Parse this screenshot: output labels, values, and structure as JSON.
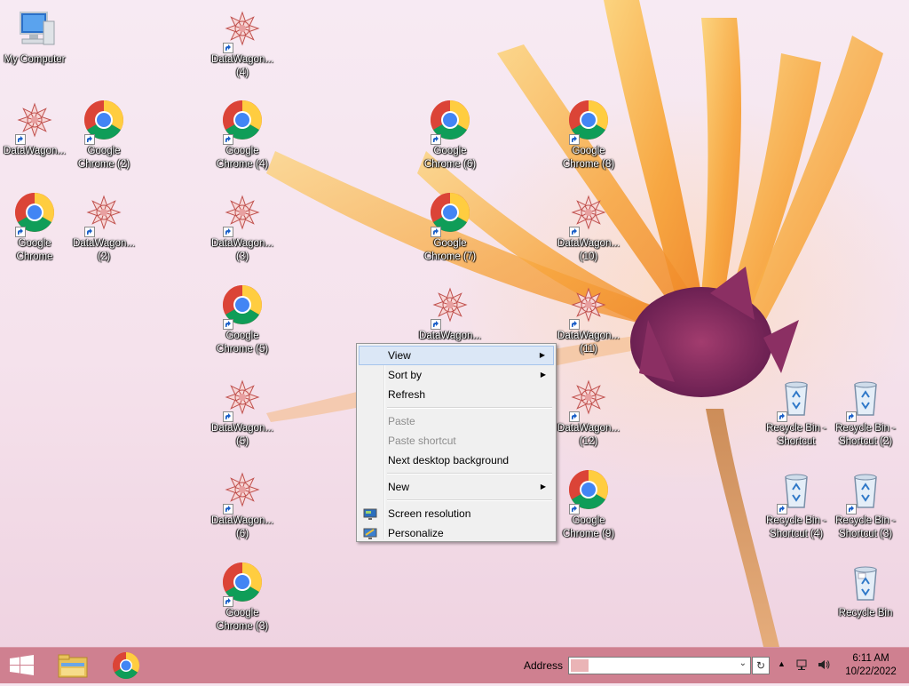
{
  "desktop": {
    "icons": [
      {
        "type": "computer",
        "label": "My Computer"
      },
      {
        "type": "datawagon",
        "label": "DataWagon..."
      },
      {
        "type": "chrome",
        "label": "Google Chrome (2)"
      },
      {
        "type": "chrome",
        "label": "Google Chrome"
      },
      {
        "type": "datawagon",
        "label": "DataWagon... (2)"
      },
      {
        "type": "datawagon",
        "label": "DataWagon... (4)"
      },
      {
        "type": "chrome",
        "label": "Google Chrome (4)"
      },
      {
        "type": "datawagon",
        "label": "DataWagon... (3)"
      },
      {
        "type": "chrome",
        "label": "Google Chrome (5)"
      },
      {
        "type": "datawagon",
        "label": "DataWagon... (5)"
      },
      {
        "type": "datawagon",
        "label": "DataWagon... (6)"
      },
      {
        "type": "chrome",
        "label": "Google Chrome (3)"
      },
      {
        "type": "chrome",
        "label": "Google Chrome (6)"
      },
      {
        "type": "chrome",
        "label": "Google Chrome (7)"
      },
      {
        "type": "datawagon",
        "label": "DataWagon..."
      },
      {
        "type": "chrome",
        "label": "Google Chrome (8)"
      },
      {
        "type": "datawagon",
        "label": "DataWagon... (10)"
      },
      {
        "type": "datawagon",
        "label": "DataWagon... (11)"
      },
      {
        "type": "datawagon",
        "label": "DataWagon... (12)"
      },
      {
        "type": "chrome",
        "label": "Google Chrome (9)"
      },
      {
        "type": "recycle",
        "label": "Recycle Bin - Shortcut"
      },
      {
        "type": "recycle",
        "label": "Recycle Bin - Shortcut (2)"
      },
      {
        "type": "recycle",
        "label": "Recycle Bin - Shortcut (4)"
      },
      {
        "type": "recycle",
        "label": "Recycle Bin - Shortcut (3)"
      },
      {
        "type": "recycle_full",
        "label": "Recycle Bin"
      }
    ]
  },
  "context_menu": {
    "view": "View",
    "sort_by": "Sort by",
    "refresh": "Refresh",
    "paste": "Paste",
    "paste_shortcut": "Paste shortcut",
    "next_background": "Next desktop background",
    "new": "New",
    "screen_resolution": "Screen resolution",
    "personalize": "Personalize",
    "submenu_arrow": "▶"
  },
  "taskbar": {
    "start_icon": "windows-logo-icon",
    "pinned": [
      {
        "name": "File Explorer",
        "icon": "folder-icon"
      },
      {
        "name": "Google Chrome",
        "icon": "chrome-icon"
      }
    ],
    "address_label": "Address",
    "address_value": "",
    "time": "6:11 AM",
    "date": "10/22/2022"
  },
  "colors": {
    "taskbar": "#cf8090",
    "menu_bg": "#f0f0f0",
    "menu_hover": "#dbe7f6",
    "wallpaper_petal": "#f7a43a",
    "wallpaper_center": "#7b2c5c"
  }
}
